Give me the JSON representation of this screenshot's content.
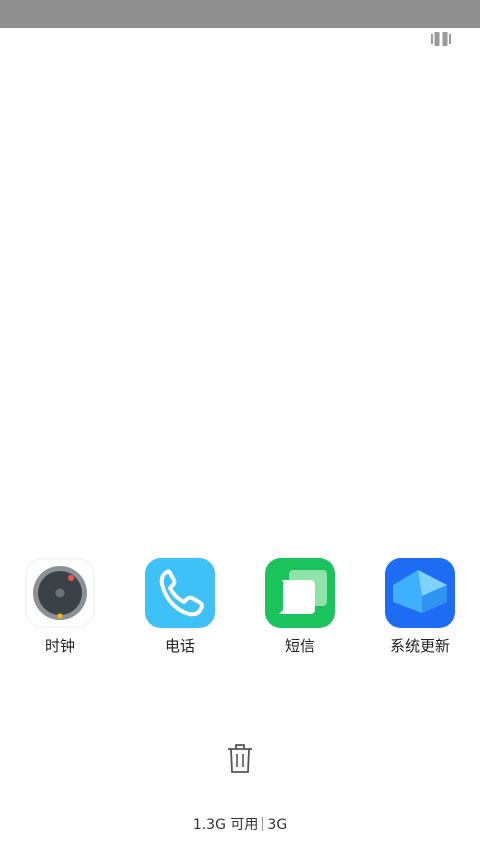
{
  "recents": {
    "apps": [
      {
        "label": "时钟",
        "icon": "clock-icon"
      },
      {
        "label": "电话",
        "icon": "phone-icon",
        "color": "#3ec1f7"
      },
      {
        "label": "短信",
        "icon": "message-icon",
        "color": "#1ac35b"
      },
      {
        "label": "系统更新",
        "icon": "system-update-icon",
        "color": "#1d6cf3"
      }
    ],
    "view_toggle_icon": "grid-view-icon",
    "clear_icon": "trash-icon",
    "memory": {
      "available": "1.3G 可用",
      "total": "3G"
    }
  },
  "colors": {
    "status_bar": "#8f8f8f",
    "background": "#ffffff"
  }
}
